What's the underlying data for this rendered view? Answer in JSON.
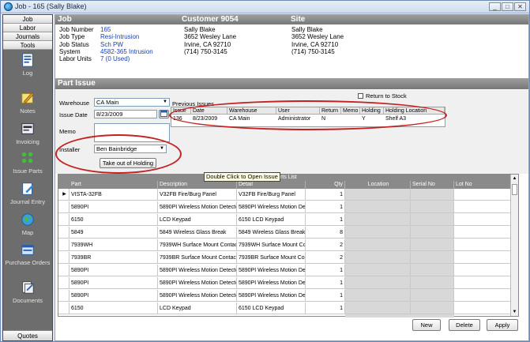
{
  "window": {
    "title": "Job - 165 (Sally Blake)",
    "controls": [
      "_",
      "□",
      "✕"
    ]
  },
  "sidebar": {
    "tabs": [
      "Job",
      "Labor",
      "Journals",
      "Tools"
    ],
    "items": [
      {
        "label": "Log",
        "icon": "log-icon"
      },
      {
        "label": "Notes",
        "icon": "notes-icon"
      },
      {
        "label": "Invoicing",
        "icon": "invoice-icon"
      },
      {
        "label": "Issue Parts",
        "icon": "issue-parts-icon"
      },
      {
        "label": "Journal Entry",
        "icon": "journal-entry-icon"
      },
      {
        "label": "Map",
        "icon": "map-icon"
      },
      {
        "label": "Purchase Orders",
        "icon": "purchase-orders-icon"
      },
      {
        "label": "Documents",
        "icon": "documents-icon"
      }
    ],
    "footer": "Quotes"
  },
  "header": {
    "job": "Job",
    "customer": "Customer 9054",
    "site": "Site"
  },
  "job": {
    "labels": [
      "Job Number",
      "Job Type",
      "Job Status",
      "System",
      "Labor Units"
    ],
    "values": [
      "165",
      "Resi-Intrusion",
      "Sch PW",
      "4582-365 Intrusion",
      "7 (0 Used)"
    ]
  },
  "customer": {
    "name": "Sally Blake",
    "address": "3652 Wesley Lane",
    "city": "Irvine, CA  92710",
    "phone": "(714) 750-3145"
  },
  "site": {
    "name": "Sally Blake",
    "address": "3652 Wesley Lane",
    "city": "Irvine, CA  92710",
    "phone": "(714) 750-3145"
  },
  "part_issue": {
    "section_title": "Part Issue",
    "warehouse_label": "Warehouse",
    "warehouse_value": "CA Main",
    "issue_date_label": "Issue Date",
    "issue_date_value": "8/23/2009",
    "memo_label": "Memo",
    "installer_label": "Installer",
    "installer_value": "Ben Bainbridge",
    "take_out_button": "Take out of Holding",
    "previous_issues_label": "Previous Issues",
    "return_to_stock_label": "Return to Stock",
    "prev_columns": [
      "Issue",
      "Date",
      "Warehouse",
      "User",
      "Return",
      "Memo",
      "Holding",
      "Holding Location"
    ],
    "prev_rows": [
      [
        "136",
        "8/23/2009",
        "CA Main",
        "Administrator",
        "N",
        "",
        "Y",
        "Shelf A3"
      ]
    ],
    "tooltip": "Double Click to Open Issue"
  },
  "parts_list": {
    "caption": "Parts List",
    "columns": [
      "Part",
      "Description",
      "Detail",
      "Qty",
      "Location",
      "Serial No",
      "Lot No"
    ],
    "rows": [
      [
        "VISTA-32FB",
        "V32FB Fire/Burg Panel",
        "V32FB Fire/Burg Panel",
        "1"
      ],
      [
        "5890PI",
        "5890PI Wireless Motion Detecto",
        "5890PI Wireless Motion Det",
        "1"
      ],
      [
        "6150",
        "LCD Keypad",
        "6150 LCD Keypad",
        "1"
      ],
      [
        "5849",
        "5849 Wireless Glass Break",
        "5849 Wireless Glass Break",
        "8"
      ],
      [
        "7939WH",
        "7939WH Surface Mount Contact",
        "7939WH Surface Mount Co",
        "2"
      ],
      [
        "7939BR",
        "7939BR Surface Mount Contact",
        "7939BR Surface Mount Con",
        "2"
      ],
      [
        "5890PI",
        "5890PI Wireless Motion Detecto",
        "5890PI Wireless Motion Det",
        "1"
      ],
      [
        "5890PI",
        "5890PI Wireless Motion Detecto",
        "5890PI Wireless Motion Det",
        "1"
      ],
      [
        "5890PI",
        "5890PI Wireless Motion Detecto",
        "5890PI Wireless Motion Det",
        "1"
      ],
      [
        "6150",
        "LCD Keypad",
        "6150 LCD Keypad",
        "1"
      ]
    ]
  },
  "actions": {
    "new": "New",
    "delete": "Delete",
    "apply": "Apply"
  }
}
